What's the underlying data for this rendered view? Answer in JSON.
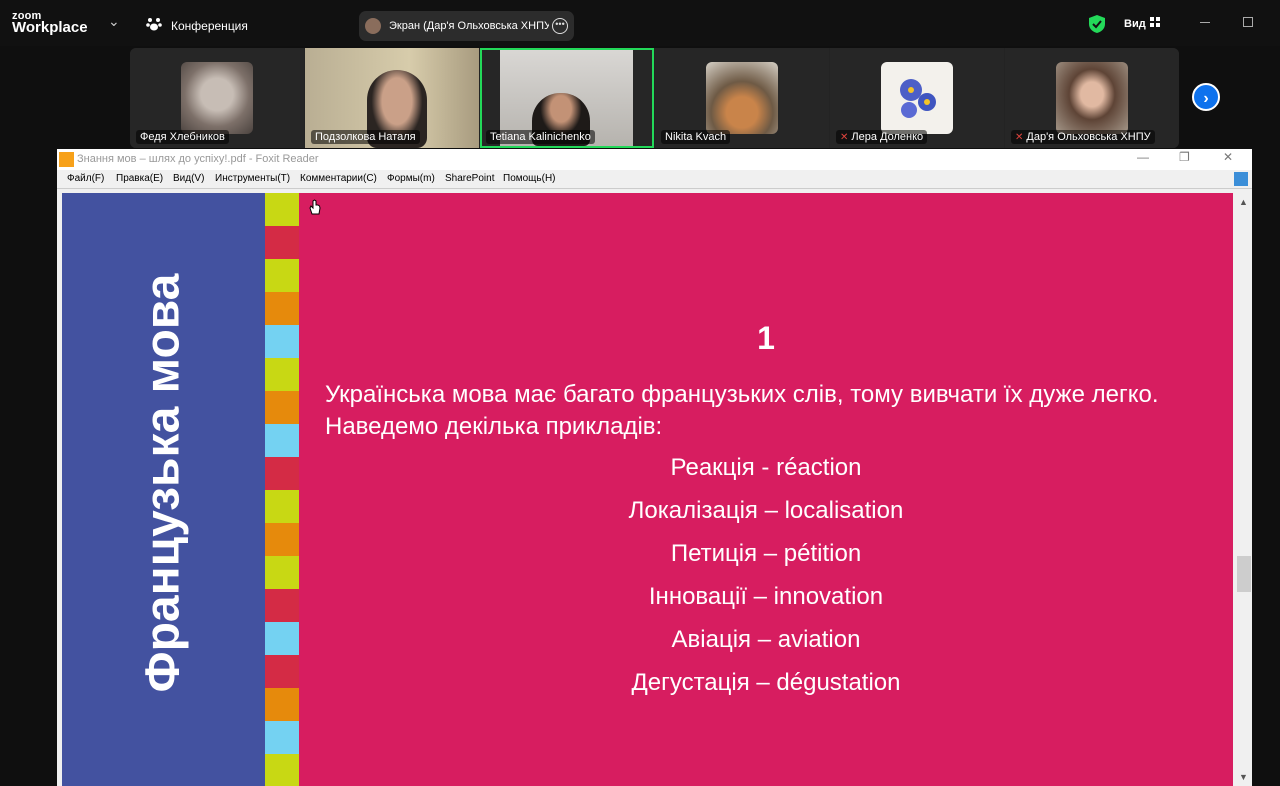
{
  "zoom": {
    "logo_top": "zoom",
    "logo_bottom": "Workplace",
    "meeting_title": "Конференция",
    "share_label": "Экран (Дар'я Ольховська ХНПУ",
    "view_label": "Вид"
  },
  "participants": [
    {
      "name": "Федя Хлебников",
      "muted": false,
      "thumb_color": "#9a8f88"
    },
    {
      "name": "Подзолкова Наталя",
      "muted": false,
      "thumb_color": "#8a7a63"
    },
    {
      "name": "Tetiana Kalinichenko",
      "muted": false,
      "thumb_color": "#c7c5c2",
      "active": true
    },
    {
      "name": "Nikita Kvach",
      "muted": false,
      "thumb_color": "#7d6a55"
    },
    {
      "name": "Лера Доленко",
      "muted": true,
      "thumb_color": "#f1eee8"
    },
    {
      "name": "Дар'я Ольховська ХНПУ",
      "muted": true,
      "thumb_color": "#8d7b6f"
    }
  ],
  "foxit": {
    "title": "Знання мов – шлях до успіху!.pdf - Foxit Reader",
    "menu": [
      "Файл(F)",
      "Правка(E)",
      "Вид(V)",
      "Инструменты(T)",
      "Комментарии(C)",
      "Формы(m)",
      "SharePoint",
      "Помощь(H)"
    ]
  },
  "slide": {
    "side_title": "Французька мова",
    "number": "1",
    "intro": "Українська мова має багато французьких слів, тому вивчати їх дуже легко. Наведемо декілька прикладів:",
    "pairs": [
      "Реакція - réaction",
      "Локалізація – localisation",
      "Петиція – pétition",
      "Інновації – innovation",
      "Авіація – aviation",
      "Дегустація – dégustation"
    ],
    "colors": {
      "background": "#d71d60",
      "left_band": "#4352a0"
    },
    "stripe_colors": [
      "#c8d814",
      "#d42b45",
      "#c8d814",
      "#e68a0c",
      "#74d2f2",
      "#c8d814",
      "#e68a0c",
      "#74d2f2",
      "#d42b45",
      "#c8d814",
      "#e68a0c",
      "#c8d814",
      "#d42b45",
      "#74d2f2",
      "#d42b45",
      "#e68a0c",
      "#74d2f2",
      "#c8d814"
    ]
  }
}
